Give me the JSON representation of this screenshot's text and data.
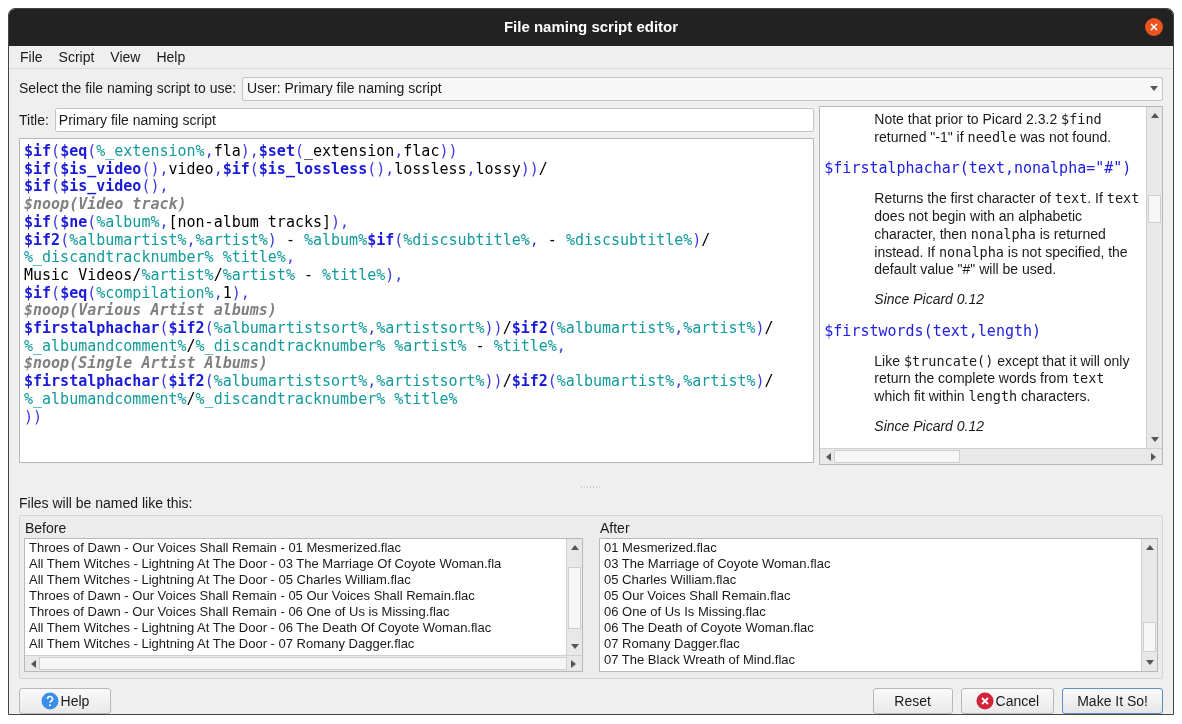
{
  "window": {
    "title": "File naming script editor"
  },
  "menu": [
    {
      "label": "File"
    },
    {
      "label": "Script"
    },
    {
      "label": "View"
    },
    {
      "label": "Help"
    }
  ],
  "script_select": {
    "label": "Select the file naming script to use:",
    "value": "User: Primary file naming script"
  },
  "title_field": {
    "label": "Title:",
    "value": "Primary file naming script"
  },
  "editor": {
    "lines": [
      [
        {
          "kind": "func",
          "text": "$if"
        },
        {
          "kind": "punct",
          "text": "("
        },
        {
          "kind": "func",
          "text": "$eq"
        },
        {
          "kind": "punct",
          "text": "("
        },
        {
          "kind": "var",
          "text": "%_extension%"
        },
        {
          "kind": "punct",
          "text": ","
        },
        {
          "kind": "plain",
          "text": "fla"
        },
        {
          "kind": "punct",
          "text": "),"
        },
        {
          "kind": "func",
          "text": "$set"
        },
        {
          "kind": "punct",
          "text": "("
        },
        {
          "kind": "plain",
          "text": "_extension"
        },
        {
          "kind": "punct",
          "text": ","
        },
        {
          "kind": "plain",
          "text": "flac"
        },
        {
          "kind": "punct",
          "text": "))"
        }
      ],
      [
        {
          "kind": "func",
          "text": "$if"
        },
        {
          "kind": "punct",
          "text": "("
        },
        {
          "kind": "func",
          "text": "$is_video"
        },
        {
          "kind": "punct",
          "text": "(),"
        },
        {
          "kind": "plain",
          "text": "video"
        },
        {
          "kind": "punct",
          "text": ","
        },
        {
          "kind": "func",
          "text": "$if"
        },
        {
          "kind": "punct",
          "text": "("
        },
        {
          "kind": "func",
          "text": "$is_lossless"
        },
        {
          "kind": "punct",
          "text": "(),"
        },
        {
          "kind": "plain",
          "text": "lossless"
        },
        {
          "kind": "punct",
          "text": ","
        },
        {
          "kind": "plain",
          "text": "lossy"
        },
        {
          "kind": "punct",
          "text": "))"
        },
        {
          "kind": "plain",
          "text": "/"
        }
      ],
      [
        {
          "kind": "func",
          "text": "$if"
        },
        {
          "kind": "punct",
          "text": "("
        },
        {
          "kind": "func",
          "text": "$is_video"
        },
        {
          "kind": "punct",
          "text": "(),"
        }
      ],
      [
        {
          "kind": "comment",
          "text": "$noop(Video track)"
        }
      ],
      [
        {
          "kind": "func",
          "text": "$if"
        },
        {
          "kind": "punct",
          "text": "("
        },
        {
          "kind": "func",
          "text": "$ne"
        },
        {
          "kind": "punct",
          "text": "("
        },
        {
          "kind": "var",
          "text": "%album%"
        },
        {
          "kind": "punct",
          "text": ","
        },
        {
          "kind": "plain",
          "text": "[non-album tracks]"
        },
        {
          "kind": "punct",
          "text": "),"
        }
      ],
      [
        {
          "kind": "func",
          "text": "$if2"
        },
        {
          "kind": "punct",
          "text": "("
        },
        {
          "kind": "var",
          "text": "%albumartist%"
        },
        {
          "kind": "punct",
          "text": ","
        },
        {
          "kind": "var",
          "text": "%artist%"
        },
        {
          "kind": "punct",
          "text": ")"
        },
        {
          "kind": "plain",
          "text": " - "
        },
        {
          "kind": "var",
          "text": "%album%"
        },
        {
          "kind": "func",
          "text": "$if"
        },
        {
          "kind": "punct",
          "text": "("
        },
        {
          "kind": "var",
          "text": "%discsubtitle%"
        },
        {
          "kind": "punct",
          "text": ","
        },
        {
          "kind": "plain",
          "text": " - "
        },
        {
          "kind": "var",
          "text": "%discsubtitle%"
        },
        {
          "kind": "punct",
          "text": ")"
        },
        {
          "kind": "plain",
          "text": "/"
        }
      ],
      [
        {
          "kind": "var",
          "text": "%_discandtracknumber% "
        },
        {
          "kind": "var",
          "text": "%title%"
        },
        {
          "kind": "punct",
          "text": ","
        }
      ],
      [
        {
          "kind": "plain",
          "text": "Music Videos/"
        },
        {
          "kind": "var",
          "text": "%artist%"
        },
        {
          "kind": "plain",
          "text": "/"
        },
        {
          "kind": "var",
          "text": "%artist%"
        },
        {
          "kind": "plain",
          "text": " - "
        },
        {
          "kind": "var",
          "text": "%title%"
        },
        {
          "kind": "punct",
          "text": "),"
        }
      ],
      [
        {
          "kind": "func",
          "text": "$if"
        },
        {
          "kind": "punct",
          "text": "("
        },
        {
          "kind": "func",
          "text": "$eq"
        },
        {
          "kind": "punct",
          "text": "("
        },
        {
          "kind": "var",
          "text": "%compilation%"
        },
        {
          "kind": "punct",
          "text": ","
        },
        {
          "kind": "plain",
          "text": "1"
        },
        {
          "kind": "punct",
          "text": "),"
        }
      ],
      [
        {
          "kind": "comment",
          "text": "$noop(Various Artist albums)"
        }
      ],
      [
        {
          "kind": "func",
          "text": "$firstalphachar"
        },
        {
          "kind": "punct",
          "text": "("
        },
        {
          "kind": "func",
          "text": "$if2"
        },
        {
          "kind": "punct",
          "text": "("
        },
        {
          "kind": "var",
          "text": "%albumartistsort%"
        },
        {
          "kind": "punct",
          "text": ","
        },
        {
          "kind": "var",
          "text": "%artistsort%"
        },
        {
          "kind": "punct",
          "text": "))"
        },
        {
          "kind": "plain",
          "text": "/"
        },
        {
          "kind": "func",
          "text": "$if2"
        },
        {
          "kind": "punct",
          "text": "("
        },
        {
          "kind": "var",
          "text": "%albumartist%"
        },
        {
          "kind": "punct",
          "text": ","
        },
        {
          "kind": "var",
          "text": "%artist%"
        },
        {
          "kind": "punct",
          "text": ")"
        },
        {
          "kind": "plain",
          "text": "/"
        }
      ],
      [
        {
          "kind": "var",
          "text": "%_albumandcomment%"
        },
        {
          "kind": "plain",
          "text": "/"
        },
        {
          "kind": "var",
          "text": "%_discandtracknumber% "
        },
        {
          "kind": "var",
          "text": "%artist%"
        },
        {
          "kind": "plain",
          "text": " - "
        },
        {
          "kind": "var",
          "text": "%title%"
        },
        {
          "kind": "punct",
          "text": ","
        }
      ],
      [
        {
          "kind": "comment",
          "text": "$noop(Single Artist Albums)"
        }
      ],
      [
        {
          "kind": "func",
          "text": "$firstalphachar"
        },
        {
          "kind": "punct",
          "text": "("
        },
        {
          "kind": "func",
          "text": "$if2"
        },
        {
          "kind": "punct",
          "text": "("
        },
        {
          "kind": "var",
          "text": "%albumartistsort%"
        },
        {
          "kind": "punct",
          "text": ","
        },
        {
          "kind": "var",
          "text": "%artistsort%"
        },
        {
          "kind": "punct",
          "text": "))"
        },
        {
          "kind": "plain",
          "text": "/"
        },
        {
          "kind": "func",
          "text": "$if2"
        },
        {
          "kind": "punct",
          "text": "("
        },
        {
          "kind": "var",
          "text": "%albumartist%"
        },
        {
          "kind": "punct",
          "text": ","
        },
        {
          "kind": "var",
          "text": "%artist%"
        },
        {
          "kind": "punct",
          "text": ")"
        },
        {
          "kind": "plain",
          "text": "/"
        }
      ],
      [
        {
          "kind": "var",
          "text": "%_albumandcomment%"
        },
        {
          "kind": "plain",
          "text": "/"
        },
        {
          "kind": "var",
          "text": "%_discandtracknumber% "
        },
        {
          "kind": "var",
          "text": "%title%"
        }
      ],
      [
        {
          "kind": "punct",
          "text": "))"
        }
      ]
    ]
  },
  "help": [
    {
      "kind": "note",
      "parts": [
        {
          "kind": "text",
          "text": "Note that prior to Picard 2.3.2 "
        },
        {
          "kind": "code",
          "text": "$find"
        },
        {
          "kind": "text",
          "text": " returned \"-1\" if "
        },
        {
          "kind": "code",
          "text": "needle"
        },
        {
          "kind": "text",
          "text": " was not found."
        }
      ]
    },
    {
      "kind": "signature",
      "parts": [
        {
          "kind": "code",
          "text": "$firstalphachar(text,nonalpha=\"#\")"
        }
      ]
    },
    {
      "kind": "note",
      "parts": [
        {
          "kind": "text",
          "text": "Returns the first character of "
        },
        {
          "kind": "code",
          "text": "text"
        },
        {
          "kind": "text",
          "text": ". If "
        },
        {
          "kind": "code",
          "text": "text"
        },
        {
          "kind": "text",
          "text": " does not begin with an alphabetic character, then "
        },
        {
          "kind": "code",
          "text": "nonalpha"
        },
        {
          "kind": "text",
          "text": " is returned instead. If "
        },
        {
          "kind": "code",
          "text": "nonalpha"
        },
        {
          "kind": "text",
          "text": " is not specified, the default value \"#\" will be used."
        }
      ]
    },
    {
      "kind": "since",
      "parts": [
        {
          "kind": "text",
          "text": "Since Picard 0.12"
        }
      ]
    },
    {
      "kind": "signature",
      "parts": [
        {
          "kind": "code",
          "text": "$firstwords(text,length)"
        }
      ]
    },
    {
      "kind": "note",
      "parts": [
        {
          "kind": "text",
          "text": "Like "
        },
        {
          "kind": "code",
          "text": "$truncate()"
        },
        {
          "kind": "text",
          "text": " except that it will only return the complete words from "
        },
        {
          "kind": "code",
          "text": "text"
        },
        {
          "kind": "text",
          "text": " which fit within "
        },
        {
          "kind": "code",
          "text": "length"
        },
        {
          "kind": "text",
          "text": " characters."
        }
      ]
    },
    {
      "kind": "since",
      "parts": [
        {
          "kind": "text",
          "text": "Since Picard 0.12"
        }
      ]
    }
  ],
  "preview": {
    "label": "Files will be named like this:",
    "before": {
      "heading": "Before",
      "rows": [
        "Throes of Dawn - Our Voices Shall Remain - 01 Mesmerized.flac",
        "All Them Witches - Lightning At The Door - 03 The Marriage Of Coyote Woman.fla",
        "All Them Witches - Lightning At The Door - 05 Charles William.flac",
        "Throes of Dawn - Our Voices Shall Remain - 05 Our Voices Shall Remain.flac",
        "Throes of Dawn - Our Voices Shall Remain - 06 One of Us is Missing.flac",
        "All Them Witches - Lightning At The Door - 06 The Death Of Coyote Woman.flac",
        "All Them Witches - Lightning At The Door - 07 Romany Dagger.flac"
      ]
    },
    "after": {
      "heading": "After",
      "rows": [
        "01 Mesmerized.flac",
        "03 The Marriage of Coyote Woman.flac",
        "05 Charles William.flac",
        "05 Our Voices Shall Remain.flac",
        "06 One of Us Is Missing.flac",
        "06 The Death of Coyote Woman.flac",
        "07 Romany Dagger.flac",
        "07 The Black Wreath of Mind.flac"
      ]
    }
  },
  "buttons": [
    {
      "kind": "help",
      "label": "Help"
    },
    {
      "kind": "reset",
      "label": "Reset"
    },
    {
      "kind": "cancel",
      "label": "Cancel"
    },
    {
      "kind": "default",
      "label": "Make It So!"
    }
  ]
}
